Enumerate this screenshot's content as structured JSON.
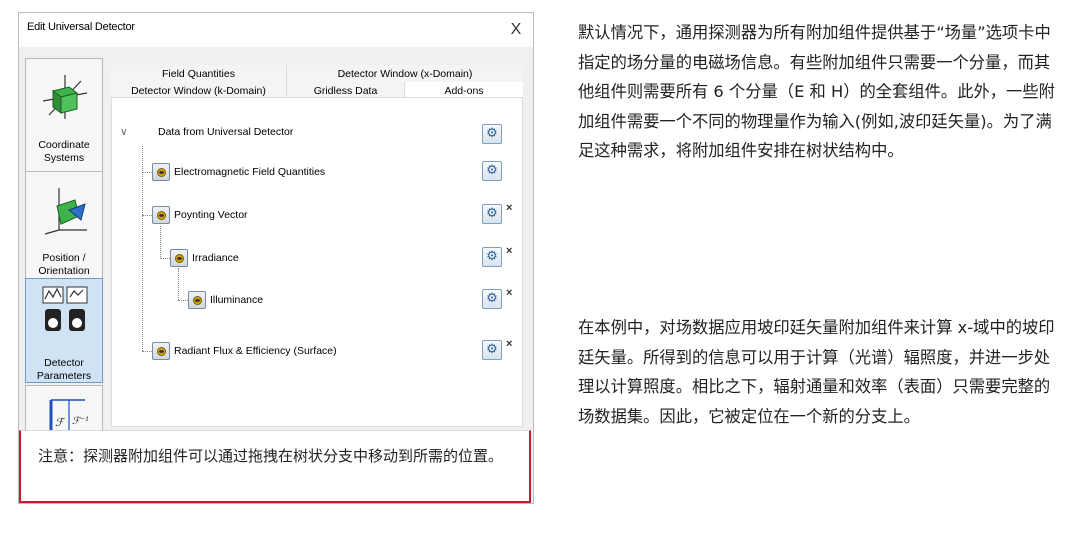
{
  "dialog": {
    "title": "Edit Universal Detector",
    "close_label": "X",
    "categories": [
      {
        "label": "Coordinate Systems",
        "icon": "cube-axes-icon"
      },
      {
        "label": "Position / Orientation",
        "icon": "coordinate-axes-icon"
      },
      {
        "label": "Detector Parameters",
        "icon": "detector-parameters-icon"
      },
      {
        "label": "",
        "icon": "fourier-transform-icon"
      }
    ],
    "tabs_row1": [
      "Field Quantities",
      "Detector Window (x-Domain)"
    ],
    "tabs_row2": [
      "Detector Window (k-Domain)",
      "Gridless Data",
      "Add-ons"
    ],
    "active_tab": "Add-ons",
    "tree": {
      "root": "Data from Universal Detector",
      "expand_glyph": "∨",
      "items": [
        {
          "label": "Electromagnetic Field Quantities",
          "removable": false
        },
        {
          "label": "Poynting Vector",
          "removable": true
        },
        {
          "label": "Irradiance",
          "removable": true
        },
        {
          "label": "Illuminance",
          "removable": true
        },
        {
          "label": "Radiant Flux & Efficiency (Surface)",
          "removable": true
        }
      ],
      "settings_glyph": "⚙",
      "remove_glyph": "×"
    }
  },
  "note": "注意：探测器附加组件可以通过拖拽在树状分支中移动到所需的位置。",
  "paragraphs": [
    "默认情况下，通用探测器为所有附加组件提供基于“场量”选项卡中指定的场分量的电磁场信息。有些附加组件只需要一个分量，而其他组件则需要所有 6 个分量（E 和 H）的全套组件。此外，一些附加组件需要一个不同的物理量作为输入(例如,波印廷矢量)。为了满足这种需求，将附加组件安排在树状结构中。",
    "在本例中，对场数据应用坡印廷矢量附加组件来计算 x-域中的坡印廷矢量。所得到的信息可以用于计算（光谱）辐照度，并进一步处理以计算照度。相比之下，辐射通量和效率（表面）只需要完整的场数据集。因此，它被定位在一个新的分支上。"
  ],
  "colors": {
    "note_border": "#c0202a",
    "selected_category": "#cfe3f5",
    "gear_blue": "#2d5f93"
  }
}
